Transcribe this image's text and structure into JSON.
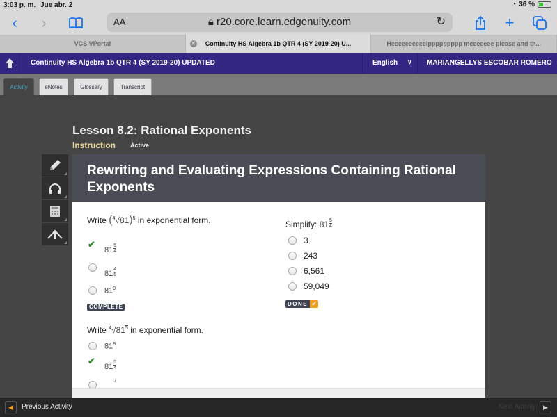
{
  "status_bar": {
    "time": "3:03 p. m.",
    "date": "Jue abr. 2",
    "battery": "36 %"
  },
  "browser": {
    "text_size_label": "AA",
    "url": "r20.core.learn.edgenuity.com",
    "tabs": [
      {
        "label": "VCS VPortal",
        "active": false
      },
      {
        "label": "Continuity HS Algebra 1b QTR 4 (SY 2019-20) U...",
        "active": true
      },
      {
        "label": "Heeeeeeeeeelppppppppp meeeeeee please and th...",
        "active": false
      }
    ]
  },
  "header": {
    "course_title": "Continuity HS Algebra 1b QTR 4 (SY 2019-20) UPDATED",
    "language": "English",
    "user_name": "MARIANGELLYS ESCOBAR ROMERO"
  },
  "app_tabs": [
    {
      "label": "Activity",
      "active": true
    },
    {
      "label": "eNotes",
      "active": false
    },
    {
      "label": "Glossary",
      "active": false
    },
    {
      "label": "Transcript",
      "active": false
    }
  ],
  "lesson": {
    "title": "Lesson 8.2: Rational Exponents",
    "type": "Instruction",
    "status": "Active"
  },
  "tools": [
    "pencil-icon",
    "headphones-icon",
    "calculator-icon",
    "collapse-icon"
  ],
  "content": {
    "heading": "Rewriting and Evaluating Expressions Containing Rational Exponents",
    "q1": {
      "prompt_prefix": "Write",
      "radical_index": "4",
      "radicand": "81",
      "outer_exponent": "5",
      "prompt_suffix": "in exponential form.",
      "options": [
        {
          "base": "81",
          "num": "5",
          "den": "4",
          "state": "correct"
        },
        {
          "base": "81",
          "num": "4",
          "den": "5",
          "state": "unselected"
        },
        {
          "base": "81",
          "exp": "9",
          "state": "unselected"
        }
      ],
      "badge": "COMPLETE"
    },
    "q2": {
      "prompt": "Simplify:",
      "base": "81",
      "num": "5",
      "den": "4",
      "options": [
        "3",
        "243",
        "6,561",
        "59,049"
      ],
      "badge": "DONE"
    },
    "q3": {
      "prompt_prefix": "Write",
      "radical_index": "4",
      "radicand": "81",
      "inner_exponent": "5",
      "prompt_suffix": "in exponential form.",
      "options": [
        {
          "base": "81",
          "exp": "9",
          "state": "unselected"
        },
        {
          "base": "81",
          "num": "5",
          "den": "4",
          "state": "correct"
        },
        {
          "num": "4",
          "state": "unselected"
        }
      ]
    }
  },
  "footer": {
    "previous": "Previous Activity",
    "next": "Next Activity"
  }
}
